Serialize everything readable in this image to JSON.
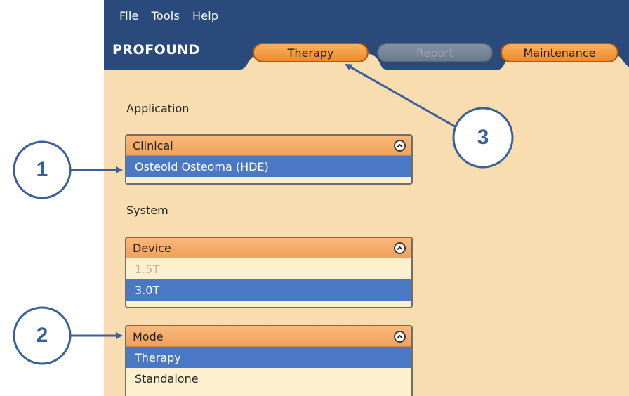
{
  "menu": [
    {
      "id": "file",
      "label": "File"
    },
    {
      "id": "tools",
      "label": "Tools"
    },
    {
      "id": "help",
      "label": "Help"
    }
  ],
  "logo": "PROFOUND",
  "tabs": [
    {
      "id": "therapy",
      "label": "Therapy",
      "state": "active"
    },
    {
      "id": "report",
      "label": "Report",
      "state": "disabled"
    },
    {
      "id": "maintenance",
      "label": "Maintenance",
      "state": "enabled"
    }
  ],
  "application": {
    "section_label": "Application",
    "panel_title": "Clinical",
    "options": [
      {
        "label": "Osteoid Osteoma (HDE)",
        "selected": true
      }
    ]
  },
  "system": {
    "section_label": "System",
    "device": {
      "panel_title": "Device",
      "options": [
        {
          "label": "1.5T",
          "disabled": true
        },
        {
          "label": "3.0T",
          "selected": true
        }
      ]
    },
    "mode": {
      "panel_title": "Mode",
      "options": [
        {
          "label": "Therapy",
          "selected": true
        },
        {
          "label": "Standalone",
          "selected": false
        }
      ]
    }
  },
  "callouts": [
    {
      "number": "1",
      "points_to": "clinical-option"
    },
    {
      "number": "2",
      "points_to": "mode-panel"
    },
    {
      "number": "3",
      "points_to": "tab-therapy"
    }
  ],
  "colors": {
    "header": "#2a4a7b",
    "background": "#f8ddb0",
    "selection": "#4b78c4",
    "tab_orange": "#ee8a2b",
    "callout": "#3a5f99"
  }
}
